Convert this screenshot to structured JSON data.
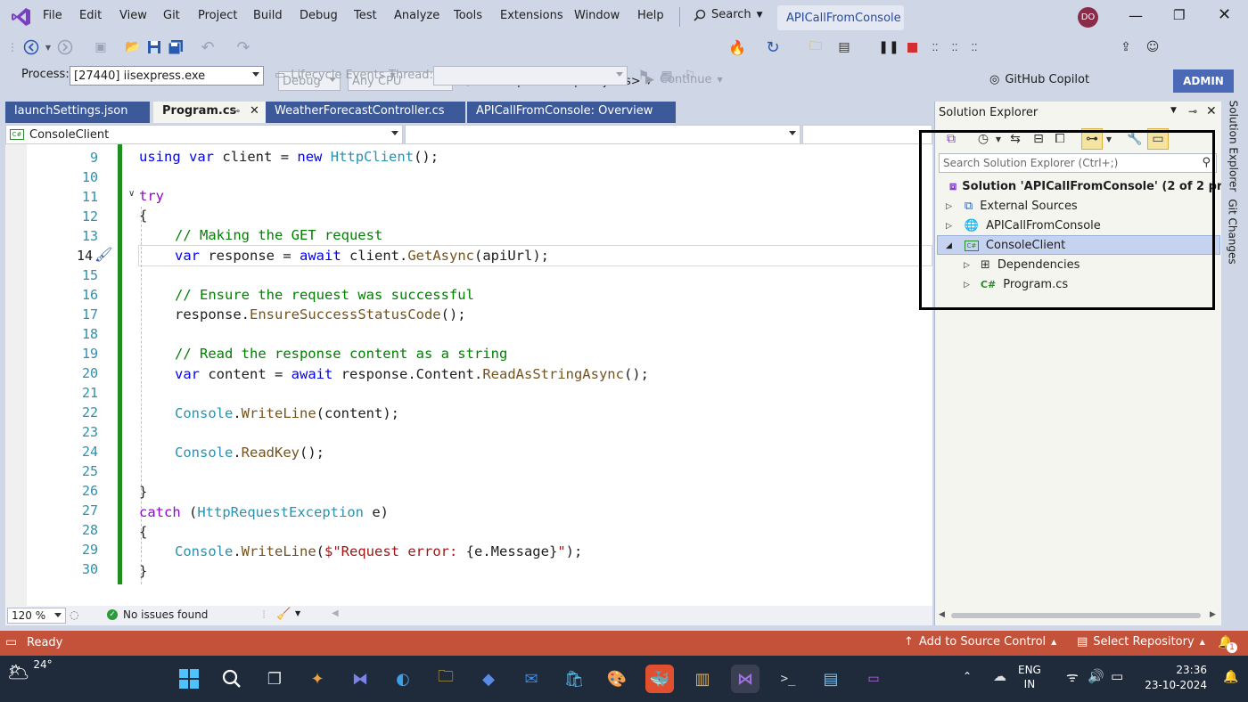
{
  "menu": {
    "items": [
      "File",
      "Edit",
      "View",
      "Git",
      "Project",
      "Build",
      "Debug",
      "Test",
      "Analyze",
      "Tools",
      "Extensions",
      "Window",
      "Help"
    ],
    "search_label": "Search",
    "solution_title": "APICallFromConsole",
    "avatar_initials": "DO"
  },
  "toolbar": {
    "config": "Debug",
    "platform": "Any CPU",
    "startup": "<Multiple Startup Projects>",
    "continue_label": "Continue",
    "copilot_label": "GitHub Copilot",
    "admin_label": "ADMIN"
  },
  "debugbar": {
    "process_label": "Process:",
    "process_value": "[27440] iisexpress.exe",
    "lifecycle_label": "Lifecycle Events",
    "thread_label": "Thread:"
  },
  "tabs": [
    {
      "label": "launchSettings.json"
    },
    {
      "label": "Program.cs"
    },
    {
      "label": "WeatherForecastController.cs"
    },
    {
      "label": "APICallFromConsole: Overview"
    }
  ],
  "navbar": {
    "project": "ConsoleClient"
  },
  "editor": {
    "line_numbers": [
      "9",
      "10",
      "11",
      "12",
      "13",
      "14",
      "15",
      "16",
      "17",
      "18",
      "19",
      "20",
      "21",
      "22",
      "23",
      "24",
      "25",
      "26",
      "27",
      "28",
      "29",
      "30"
    ],
    "zoom": "120 %",
    "issues": "No issues found"
  },
  "code": {
    "l9": [
      "using",
      "var",
      "client",
      "=",
      "new",
      "HttpClient",
      "();"
    ],
    "l11": "try",
    "l12": "{",
    "l13": "// Making the GET request",
    "l14": [
      "var",
      "response = ",
      "await",
      "client.",
      "GetAsync",
      "(apiUrl);"
    ],
    "l16": "// Ensure the request was successful",
    "l17": [
      "response.",
      "EnsureSuccessStatusCode",
      "();"
    ],
    "l19": "// Read the response content as a string",
    "l20": [
      "var",
      "content = ",
      "await",
      "response.Content.",
      "ReadAsStringAsync",
      "();"
    ],
    "l22": [
      "Console",
      ".",
      "WriteLine",
      "(content);"
    ],
    "l24": [
      "Console",
      ".",
      "ReadKey",
      "();"
    ],
    "l26": "}",
    "l27": [
      "catch",
      " (",
      "HttpRequestException",
      " e)"
    ],
    "l28": "{",
    "l29": [
      "Console",
      ".",
      "WriteLine",
      "(",
      "$\"Request error: ",
      "{e.Message}",
      "\"",
      ");"
    ],
    "l30": "}"
  },
  "solution_explorer": {
    "title": "Solution Explorer",
    "search_placeholder": "Search Solution Explorer (Ctrl+;)",
    "solution": "Solution 'APICallFromConsole' (2 of 2 projects)",
    "items": [
      "External Sources",
      "APICallFromConsole",
      "ConsoleClient",
      "Dependencies",
      "Program.cs"
    ]
  },
  "side_tabs": [
    "Solution Explorer",
    "Git Changes"
  ],
  "status": {
    "ready": "Ready",
    "add_source": "Add to Source Control",
    "select_repo": "Select Repository",
    "notif_count": "1"
  },
  "taskbar": {
    "temperature": "24°",
    "lang1": "ENG",
    "lang2": "IN",
    "time": "23:36",
    "date": "23-10-2024"
  },
  "colors": {
    "accent": "#3c5a9a",
    "status_bar": "#c4523a",
    "change_bar": "#1e8e1e",
    "selection": "#c5d3f0"
  }
}
